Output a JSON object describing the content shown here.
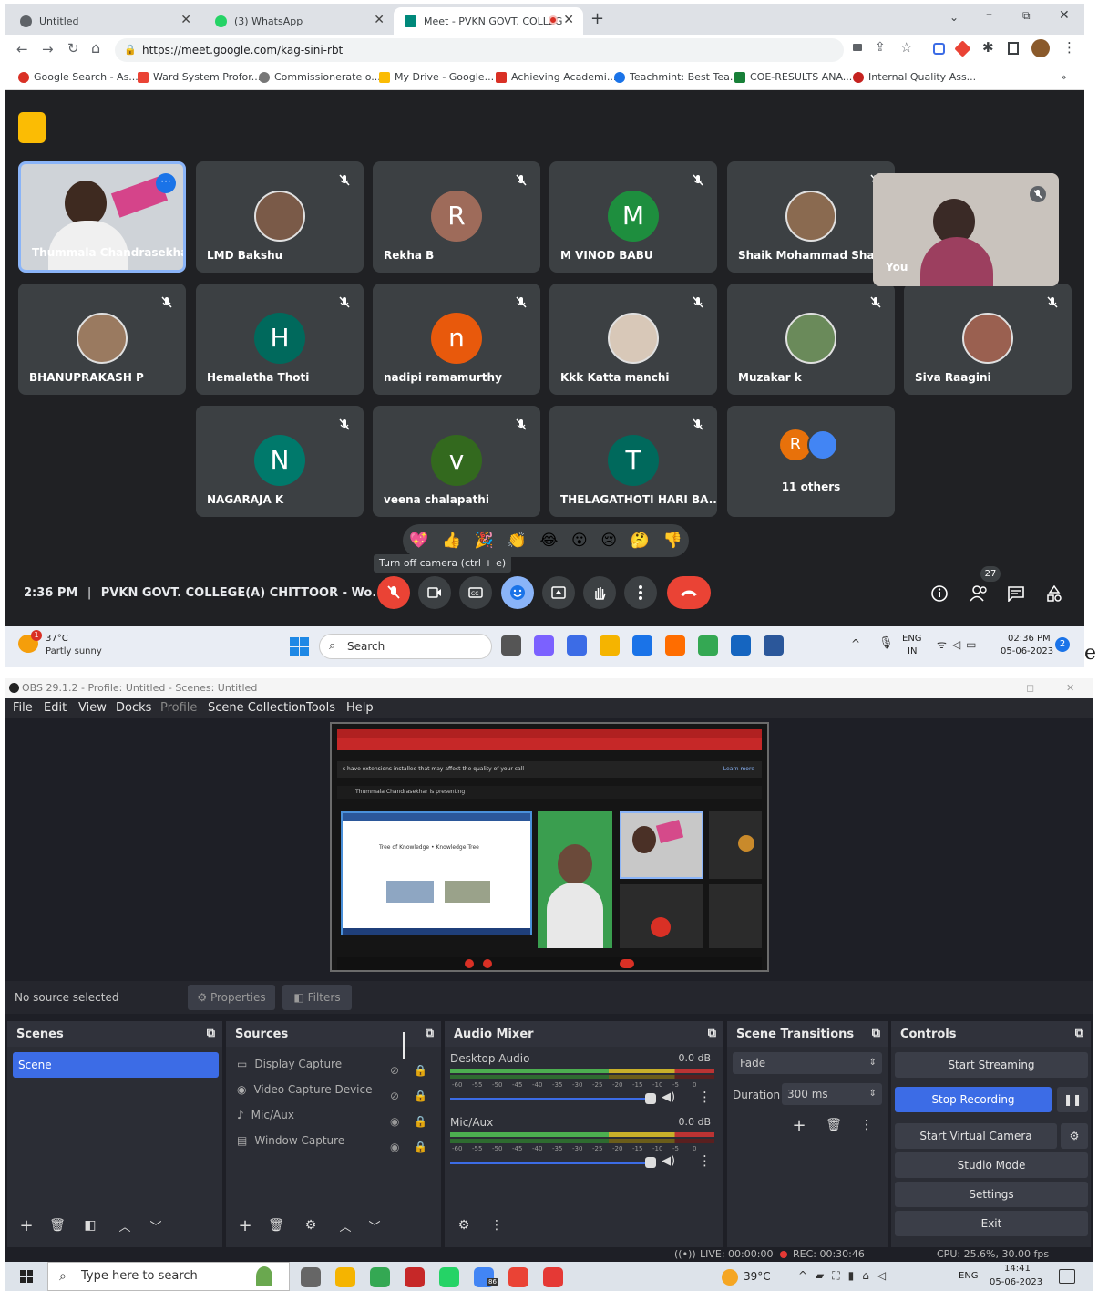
{
  "chrome": {
    "tabs": [
      {
        "label": "Untitled"
      },
      {
        "label": "(3) WhatsApp"
      },
      {
        "label": "Meet - PVKN GOVT. COLLEG"
      }
    ],
    "new_tab": "+",
    "url": "https://meet.google.com/kag-sini-rbt",
    "bookmarks": [
      "Google Search - As...",
      "Ward System Profor...",
      "Commissionerate o...",
      "My Drive - Google...",
      "Achieving Academi...",
      "Teachmint: Best Tea...",
      "COE-RESULTS ANA...",
      "Internal Quality Ass..."
    ],
    "bookmarks_more": "»"
  },
  "meet": {
    "participants": [
      {
        "name": "Thummala Chandrasekhar",
        "avatar": "photo"
      },
      {
        "name": "LMD Bakshu",
        "avatar": "photo"
      },
      {
        "name": "Rekha B",
        "initial": "R",
        "color": "#9e6b5a"
      },
      {
        "name": "M VINOD BABU",
        "initial": "M",
        "color": "#1e8e3e"
      },
      {
        "name": "Shaik Mohammad Shafiul",
        "avatar": "photo"
      },
      {
        "name": "BHANUPRAKASH P",
        "avatar": "photo"
      },
      {
        "name": "Hemalatha Thoti",
        "initial": "H",
        "color": "#00695c"
      },
      {
        "name": "nadipi ramamurthy",
        "initial": "n",
        "color": "#e8590c"
      },
      {
        "name": "Kkk Katta manchi",
        "avatar": "photo"
      },
      {
        "name": "Muzakar k",
        "avatar": "photo"
      },
      {
        "name": "Siva Raagini",
        "avatar": "photo"
      },
      {
        "name": "NAGARAJA K",
        "initial": "N",
        "color": "#00796b"
      },
      {
        "name": "veena chalapathi",
        "initial": "v",
        "color": "#33691e"
      },
      {
        "name": "THELAGATHOTI HARI BA...",
        "initial": "T",
        "color": "#00695c"
      }
    ],
    "others": {
      "label": "11 others",
      "initial": "R"
    },
    "self_label": "You",
    "reactions": [
      "💖",
      "👍",
      "🎉",
      "👏",
      "😂",
      "😮",
      "😢",
      "🤔",
      "👎"
    ],
    "tooltip": "Turn off camera (ctrl + e)",
    "time": "2:36 PM",
    "separator": "|",
    "meeting_title": "PVKN GOVT. COLLEGE(A) CHITTOOR - Wo...",
    "people_count": "27"
  },
  "taskbar1": {
    "weather_temp": "37°C",
    "weather_desc": "Partly sunny",
    "weather_badge": "1",
    "search": "Search",
    "lang": "ENG",
    "region": "IN",
    "time": "02:36 PM",
    "date": "05-06-2023",
    "notif": "2"
  },
  "trailing_char": "e",
  "obs": {
    "title": "OBS 29.1.2 - Profile: Untitled - Scenes: Untitled",
    "menu": [
      "File",
      "Edit",
      "View",
      "Docks",
      "Profile",
      "Scene Collection",
      "Tools",
      "Help"
    ],
    "no_source": "No source selected",
    "properties": "Properties",
    "filters": "Filters",
    "scenes_title": "Scenes",
    "scene_item": "Scene",
    "sources_title": "Sources",
    "sources": [
      "Display Capture",
      "Video Capture Device",
      "Mic/Aux",
      "Window Capture"
    ],
    "mixer_title": "Audio Mixer",
    "channels": [
      {
        "name": "Desktop Audio",
        "db": "0.0 dB"
      },
      {
        "name": "Mic/Aux",
        "db": "0.0 dB"
      }
    ],
    "meter_ticks": [
      "-60",
      "-55",
      "-50",
      "-45",
      "-40",
      "-35",
      "-30",
      "-25",
      "-20",
      "-15",
      "-10",
      "-5",
      "0"
    ],
    "transitions_title": "Scene Transitions",
    "transition": "Fade",
    "duration_label": "Duration",
    "duration_value": "300 ms",
    "controls_title": "Controls",
    "controls": [
      "Start Streaming",
      "Stop Recording",
      "Start Virtual Camera",
      "Studio Mode",
      "Settings",
      "Exit"
    ],
    "status_live": "LIVE: 00:00:00",
    "status_rec": "REC: 00:30:46",
    "status_cpu": "CPU: 25.6%, 30.00 fps",
    "accent": "#3c6ce6",
    "preview": {
      "warn": "s have extensions installed that may affect the quality of your call",
      "learn": "Learn more",
      "presenting": "Thummala Chandrasekhar is presenting",
      "slide_title": "Tree of Knowledge • Knowledge Tree"
    }
  },
  "taskbar2": {
    "search": "Type here to search",
    "temp": "39°C",
    "lang": "ENG",
    "time": "14:41",
    "date": "05-06-2023",
    "badge": "86"
  }
}
